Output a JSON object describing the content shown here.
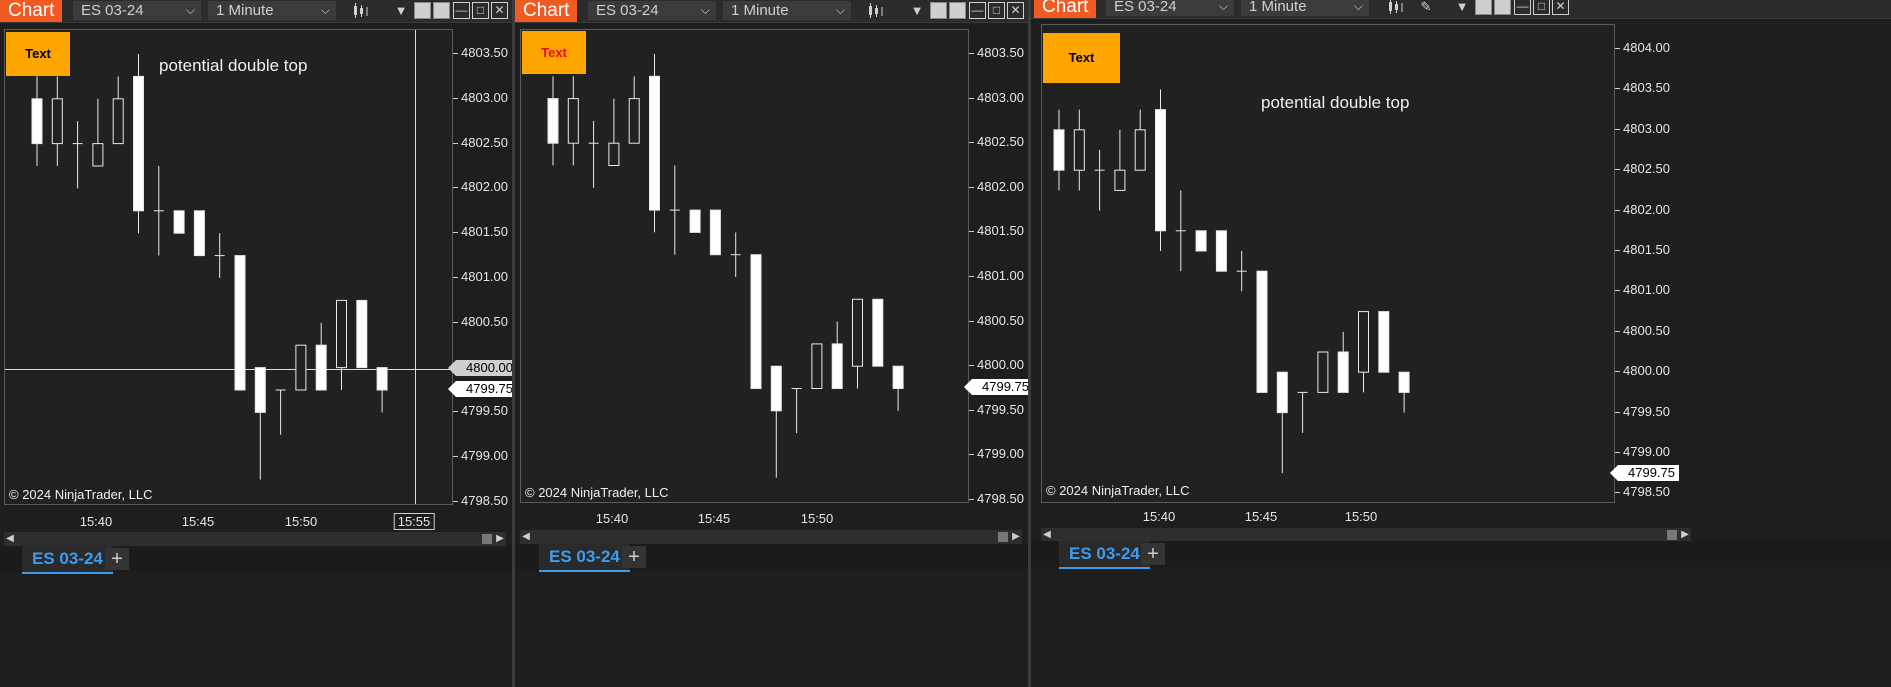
{
  "app_tab_label": "Chart",
  "instrument": "ES 03-24",
  "interval": "1 Minute",
  "text_box_label": "Text",
  "annotation": "potential double top",
  "copyright": "© 2024 NinjaTrader, LLC",
  "current_price": "4799.75",
  "crosshair_price": "4800.00",
  "crosshair_time": "15:55",
  "add_tab_label": "+",
  "colors": {
    "chart_tab": "#f15a22",
    "text_box": "#ffa500",
    "instrument_tab": "#3d9cf0",
    "text_box_red_text": "#e81010"
  },
  "panels": [
    {
      "price_labels": [
        "4803.50",
        "4803.00",
        "4802.50",
        "4802.00",
        "4801.50",
        "4801.00",
        "4800.50",
        "4800.00",
        "4799.50",
        "4799.00",
        "4798.50"
      ],
      "time_labels": [
        "15:40",
        "15:45",
        "15:50"
      ]
    },
    {
      "price_labels": [
        "4803.50",
        "4803.00",
        "4802.50",
        "4802.00",
        "4801.50",
        "4801.00",
        "4800.50",
        "4800.00",
        "4799.50",
        "4799.00",
        "4798.50"
      ],
      "time_labels": [
        "15:40",
        "15:45",
        "15:50"
      ]
    },
    {
      "price_labels": [
        "4804.00",
        "4803.50",
        "4803.00",
        "4802.50",
        "4802.00",
        "4801.50",
        "4801.00",
        "4800.50",
        "4800.00",
        "4799.50",
        "4799.00",
        "4798.50"
      ],
      "time_labels": [
        "15:40",
        "15:45",
        "15:50"
      ]
    }
  ],
  "bars": [
    [
      "15:35",
      4803.0,
      4803.25,
      4802.25,
      4802.5
    ],
    [
      "15:36",
      4802.5,
      4803.25,
      4802.25,
      4803.0
    ],
    [
      "15:37",
      4802.5,
      4802.75,
      4802.0,
      4802.5
    ],
    [
      "15:38",
      4802.25,
      4803.0,
      4802.25,
      4802.5
    ],
    [
      "15:39",
      4802.5,
      4803.25,
      4802.5,
      4803.0
    ],
    [
      "15:40",
      4803.25,
      4803.5,
      4801.5,
      4801.75
    ],
    [
      "15:41",
      4801.75,
      4802.25,
      4801.25,
      4801.75
    ],
    [
      "15:42",
      4801.75,
      4801.75,
      4801.5,
      4801.5
    ],
    [
      "15:43",
      4801.75,
      4801.75,
      4801.25,
      4801.25
    ],
    [
      "15:44",
      4801.25,
      4801.5,
      4801.0,
      4801.25
    ],
    [
      "15:45",
      4801.25,
      4801.25,
      4799.75,
      4799.75
    ],
    [
      "15:46",
      4800.0,
      4800.0,
      4798.75,
      4799.5
    ],
    [
      "15:47",
      4799.75,
      4799.75,
      4799.25,
      4799.75
    ],
    [
      "15:48",
      4799.75,
      4800.25,
      4799.75,
      4800.25
    ],
    [
      "15:49",
      4800.25,
      4800.5,
      4799.75,
      4799.75
    ],
    [
      "15:50",
      4800.0,
      4800.75,
      4799.75,
      4800.75
    ],
    [
      "15:51",
      4800.75,
      4800.75,
      4800.0,
      4800.0
    ],
    [
      "15:52",
      4800.0,
      4800.0,
      4799.5,
      4799.75
    ]
  ]
}
